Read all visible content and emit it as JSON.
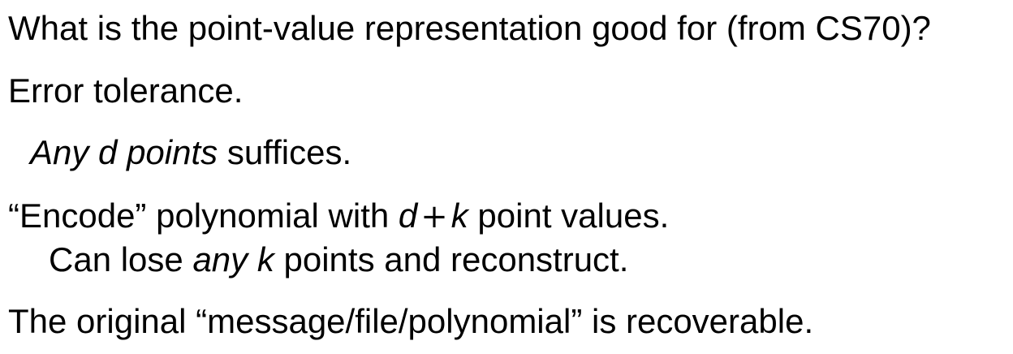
{
  "slide": {
    "question": "What is the point-value representation good for (from CS70)?",
    "point1": "Error tolerance.",
    "point2": {
      "italic": "Any d points",
      "rest": " suffices."
    },
    "point3": {
      "before": "“Encode” polynomial with ",
      "var_d": "d",
      "plus": "+",
      "var_k": "k",
      "after": " point values."
    },
    "point4": {
      "before": "Can lose ",
      "italic": "any k",
      "after": " points and reconstruct."
    },
    "point5": "The original “message/file/polynomial” is recoverable."
  }
}
